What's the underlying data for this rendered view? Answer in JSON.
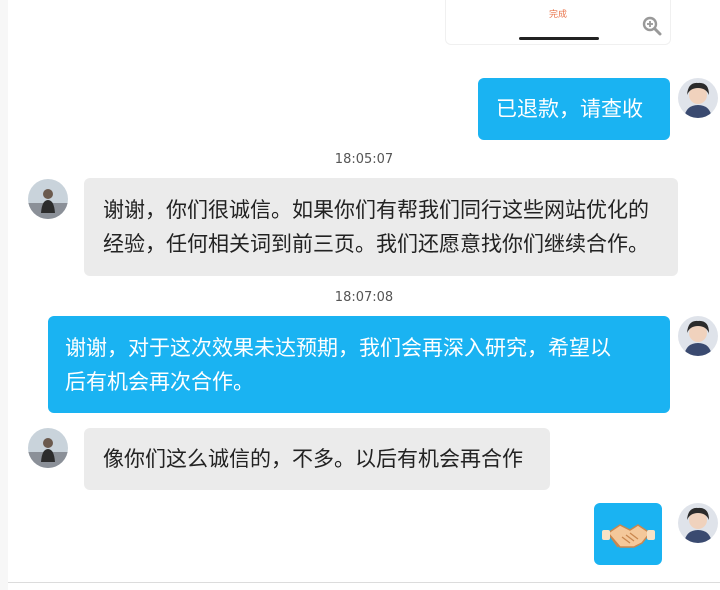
{
  "top_card": {
    "done_label": "完成",
    "zoom_icon": "zoom-in-icon"
  },
  "messages": [
    {
      "id": "m1",
      "side": "right",
      "lines": [
        "已退款，请查收"
      ]
    },
    {
      "id": "t1",
      "type": "time",
      "text": "18:05:07"
    },
    {
      "id": "m2",
      "side": "left",
      "lines": [
        "谢谢，你们很诚信。如果你们有帮我们同行这些网站优化的",
        "经验，任何相关词到前三页。我们还愿意找你们继续合作。"
      ]
    },
    {
      "id": "t2",
      "type": "time",
      "text": "18:07:08"
    },
    {
      "id": "m3",
      "side": "right",
      "lines": [
        "谢谢，对于这次效果未达预期，我们会再深入研究，希望以",
        "后有机会再次合作。"
      ]
    },
    {
      "id": "m4",
      "side": "left",
      "lines": [
        "像你们这么诚信的，不多。以后有机会再合作"
      ]
    },
    {
      "id": "m5",
      "side": "right",
      "emoji": "handshake-emoji"
    }
  ],
  "colors": {
    "outgoing_bubble": "#1ab3f2",
    "incoming_bubble": "#ebebeb",
    "done_text": "#e8734a"
  }
}
